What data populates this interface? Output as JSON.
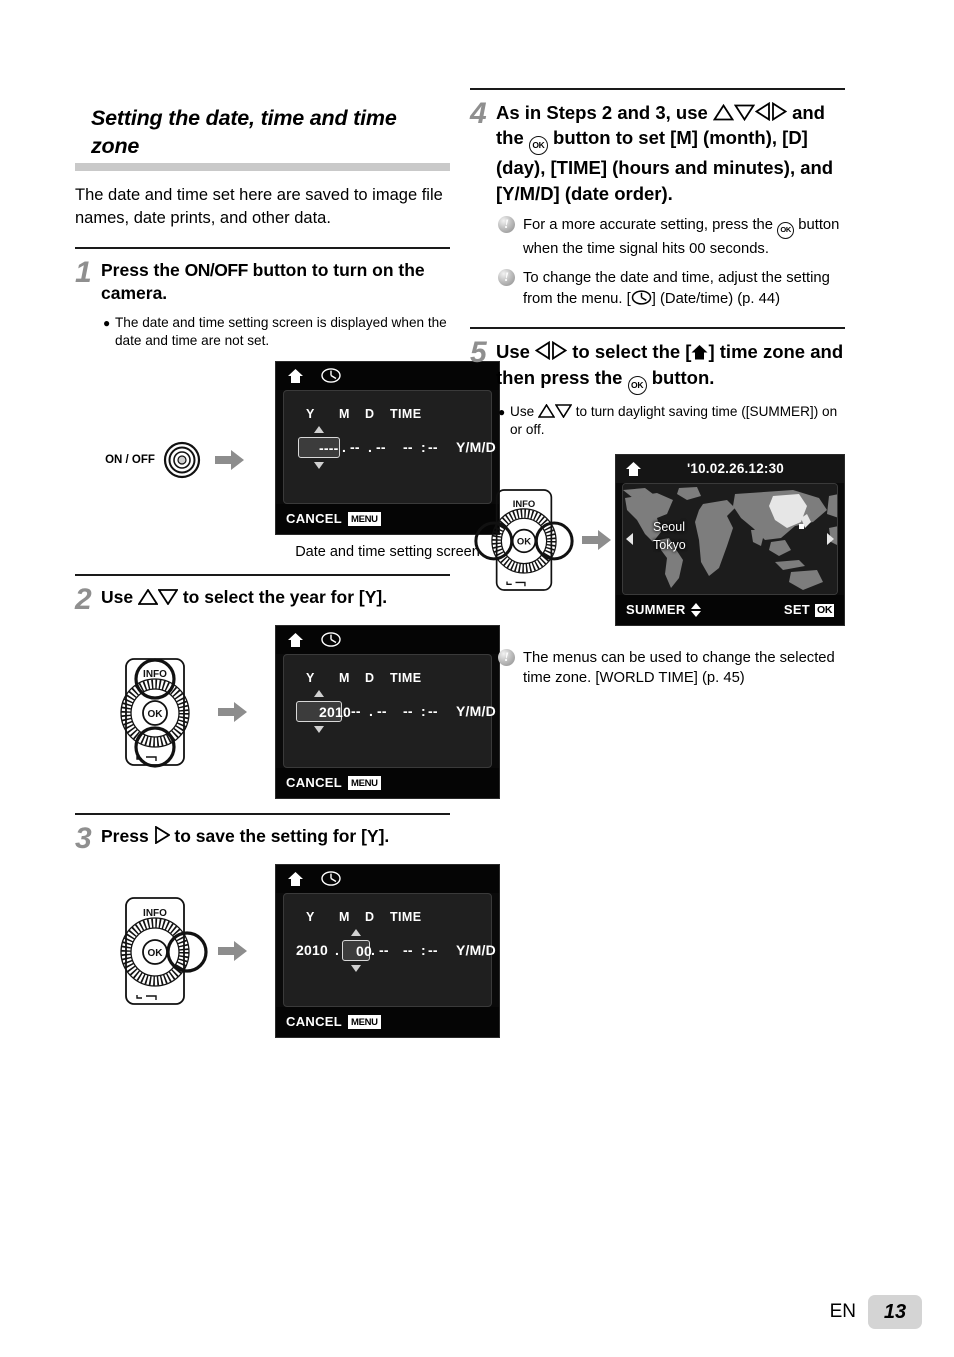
{
  "section": {
    "title": "Setting the date, time and time zone",
    "intro": "The date and time set here are saved to image file names, date prints, and other data."
  },
  "steps": {
    "s1": {
      "num": "1",
      "text_a": "Press the ",
      "text_b": "ON/OFF",
      "text_c": " button to turn on the camera.",
      "bullet": "The date and time setting screen is displayed when the date and time are not set.",
      "caption": "Date and time setting screen",
      "button_label": "ON / OFF"
    },
    "s2": {
      "num": "2",
      "text_a": "Use ",
      "text_b": " to select the year for [Y]."
    },
    "s3": {
      "num": "3",
      "text_a": "Press ",
      "text_b": " to save the setting for [Y]."
    },
    "s4": {
      "num": "4",
      "text_a": "As in Steps 2 and 3, use ",
      "text_b": " and the ",
      "text_c": " button to set [M] (month), [D] (day), [TIME] (hours and minutes), and [Y/M/D] (date order).",
      "note1_a": "For a more accurate setting, press the ",
      "note1_b": " button when the time signal hits 00 seconds.",
      "note2_a": "To change the date and time, adjust the setting from the menu. [",
      "note2_b": "] (Date/time) (p. 44)"
    },
    "s5": {
      "num": "5",
      "text_a": "Use ",
      "text_b": " to select the [",
      "text_c": "] time zone and then press the ",
      "text_d": " button.",
      "bullet_a": "Use ",
      "bullet_b": " to turn daylight saving time ([SUMMER]) on or off.",
      "note_text": "The menus can be used to change the selected time zone. [WORLD TIME] (p. 45)"
    }
  },
  "lcd_common": {
    "header_y": "Y",
    "header_m": "M",
    "header_d": "D",
    "header_time": "TIME",
    "order_label": "Y/M/D",
    "cancel_label": "CANCEL",
    "menu_badge": "MENU",
    "home_icon": "home-icon",
    "clock_icon": "clock-icon"
  },
  "lcd1": {
    "year": "----",
    "month": "--",
    "day": "--",
    "hour": "--",
    "minute": "--"
  },
  "lcd2": {
    "year": "2010",
    "month": "--",
    "day": "--",
    "hour": "--",
    "minute": "--"
  },
  "lcd3": {
    "year": "2010",
    "month": "00",
    "day": "--",
    "hour": "--",
    "minute": "--"
  },
  "lcd_map": {
    "datetime": "'10.02.26.12:30",
    "city1": "Seoul",
    "city2": "Tokyo",
    "summer_label": "SUMMER",
    "set_label": "SET",
    "ok_badge": "OK"
  },
  "pad": {
    "info_label": "INFO",
    "ok_label": "OK"
  },
  "footer": {
    "lang": "EN",
    "page": "13"
  },
  "colors": {
    "rule": "#1a1a1a",
    "section_band": "#c9c9c9",
    "step_number": "#8f8f8f",
    "page_badge": "#d4d4d4",
    "lcd_bg": "#0a0a0a",
    "lcd_panel": "#1f1f1f",
    "map_land": "#7d7d7d",
    "map_highlight": "#e6e6e6"
  }
}
